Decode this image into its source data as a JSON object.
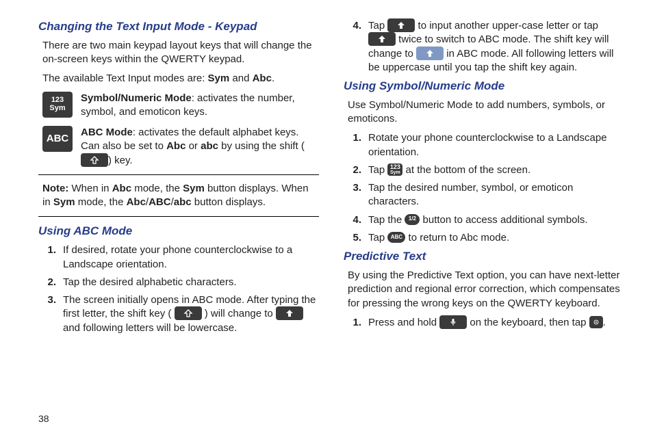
{
  "page_number": "38",
  "col1": {
    "h1": "Changing the Text Input Mode - Keypad",
    "p1": "There are two main keypad layout keys that will change the on-screen keys within the QWERTY keypad.",
    "p2a": "The available Text Input modes are: ",
    "p2b": "Sym",
    "p2c": " and ",
    "p2d": "Abc",
    "p2e": ".",
    "iconrow1": {
      "icon_l1": "123",
      "icon_l2": "Sym",
      "desc_b": "Symbol/Numeric Mode",
      "desc_r": ": activates the number, symbol, and emoticon keys."
    },
    "iconrow2": {
      "icon": "ABC",
      "desc_b": "ABC Mode",
      "desc_r1": ": activates the default alphabet keys. Can also be set to ",
      "desc_r2": "Abc",
      "desc_r3": " or ",
      "desc_r4": "abc",
      "desc_r5": " by using the shift (",
      "desc_r6": ") key."
    },
    "note_b": "Note:",
    "note1": " When in ",
    "note2": "Abc",
    "note3": " mode, the ",
    "note4": "Sym",
    "note5": " button displays. When in ",
    "note6": "Sym",
    "note7": " mode, the ",
    "note8": "Abc",
    "note9": "/",
    "note10": "ABC",
    "note11": "/",
    "note12": "abc",
    "note13": " button displays.",
    "h2": "Using ABC Mode",
    "li1": "If desired, rotate your phone counterclockwise to a Landscape orientation.",
    "li2": " Tap the desired alphabetic characters.",
    "li3a": "The screen initially opens in ABC mode. After typing the first letter, the shift key ( ",
    "li3b": " ) will change to ",
    "li3c": " and following letters will be lowercase."
  },
  "col2": {
    "li4a": "Tap ",
    "li4b": " to input another upper-case letter or tap ",
    "li4c": " twice to switch to ABC mode. The shift key will change to ",
    "li4d": " in ABC mode. All following letters will be uppercase until you tap the shift key again.",
    "h1": "Using Symbol/Numeric Mode",
    "p1": "Use Symbol/Numeric Mode to add numbers, symbols, or emoticons.",
    "s_li1": "Rotate your phone counterclockwise to a Landscape orientation.",
    "s_li2a": "Tap ",
    "s_li2b": " at the bottom of the screen.",
    "s_li3": "Tap the desired number, symbol, or emoticon characters.",
    "s_li4a": "Tap the ",
    "s_li4b": " button to access additional symbols.",
    "s_li5a": "Tap ",
    "s_li5b": " to return to Abc mode.",
    "sym_icon_l1": "123",
    "sym_icon_l2": "Sym",
    "frac_icon": "1/2",
    "abc_icon": "ABC",
    "h2": "Predictive Text",
    "p2": "By using the Predictive Text option, you can have next-letter prediction and regional error correction, which compensates for pressing the wrong keys on the QWERTY keyboard.",
    "p_li1a": "Press and hold ",
    "p_li1b": " on the keyboard, then tap ",
    "p_li1c": "."
  }
}
